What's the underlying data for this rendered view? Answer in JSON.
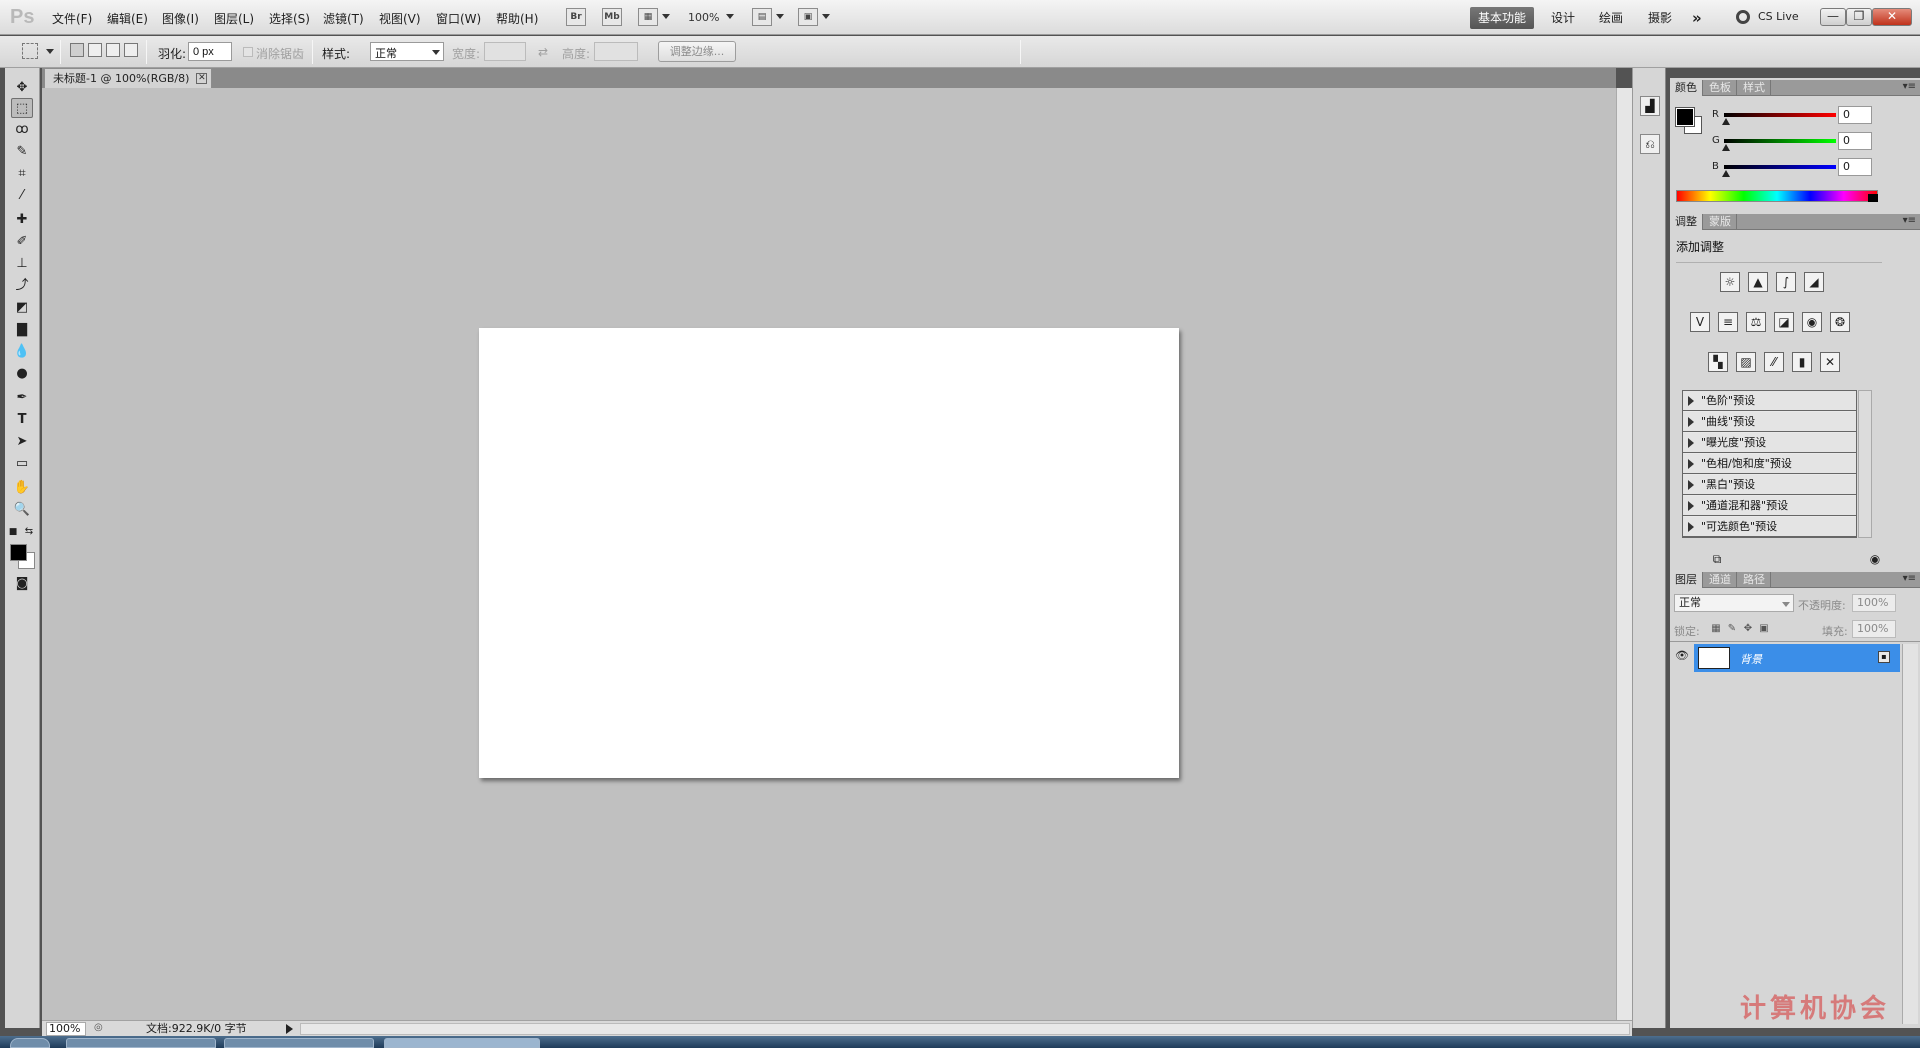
{
  "app": {
    "logo": "Ps"
  },
  "menu": {
    "items": [
      "文件(F)",
      "编辑(E)",
      "图像(I)",
      "图层(L)",
      "选择(S)",
      "滤镜(T)",
      "视图(V)",
      "窗口(W)",
      "帮助(H)"
    ],
    "bridge_label": "Br",
    "minibridge_label": "Mb",
    "zoom": "100%"
  },
  "workspaces": {
    "essentials": "基本功能",
    "design": "设计",
    "painting": "绘画",
    "photography": "摄影",
    "more": "»"
  },
  "cslive": "CS Live",
  "window_controls": {
    "minimize": "—",
    "restore": "❐",
    "close": "✕"
  },
  "options": {
    "feather_label": "羽化:",
    "feather_value": "0 px",
    "antialias_label": "消除锯齿",
    "style_label": "样式:",
    "style_value": "正常",
    "width_label": "宽度:",
    "height_label": "高度:",
    "refine_edge": "调整边缘..."
  },
  "document": {
    "tab_title": "未标题-1 @ 100%(RGB/8)",
    "tab_close": "✕",
    "status_zoom": "100%",
    "status_doc": "文档:922.9K/0 字节"
  },
  "panels": {
    "color_tabs": [
      "颜色",
      "色板",
      "样式"
    ],
    "color": {
      "r_label": "R",
      "g_label": "G",
      "b_label": "B",
      "r_value": "0",
      "g_value": "0",
      "b_value": "0"
    },
    "adjust_tabs": [
      "调整",
      "蒙版"
    ],
    "adjust_title": "添加调整",
    "presets": [
      "\"色阶\"预设",
      "\"曲线\"预设",
      "\"曝光度\"预设",
      "\"色相/饱和度\"预设",
      "\"黑白\"预设",
      "\"通道混和器\"预设",
      "\"可选颜色\"预设"
    ],
    "layer_tabs": [
      "图层",
      "通道",
      "路径"
    ],
    "layers": {
      "blend_mode": "正常",
      "opacity_label": "不透明度:",
      "opacity_value": "100%",
      "lock_label": "锁定:",
      "fill_label": "填充:",
      "fill_value": "100%",
      "layer_name": "背景"
    },
    "menu_glyph": "▾≡"
  },
  "watermark": "计算机协会",
  "colors": {
    "accent": "#3b8ee8",
    "workspace_active": "#555555",
    "canvas_bg": "#c0c0c0"
  }
}
